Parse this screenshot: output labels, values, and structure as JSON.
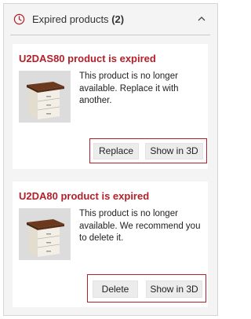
{
  "header": {
    "title": "Expired products",
    "count": "(2)",
    "clock_icon": "clock-icon",
    "chevron_icon": "chevron-up-icon"
  },
  "products": [
    {
      "title": "U2DAS80 product is expired",
      "message": "This product is no longer available. Replace it with another.",
      "primary_label": "Replace",
      "show3d_label": "Show in 3D"
    },
    {
      "title": "U2DA80 product is expired",
      "message": "This product is no longer available. We recommend you to delete it.",
      "primary_label": "Delete",
      "show3d_label": "Show in 3D"
    }
  ],
  "colors": {
    "accent": "#b3202a",
    "panel_bg": "#f4f4f4",
    "button_bg": "#ececec"
  }
}
